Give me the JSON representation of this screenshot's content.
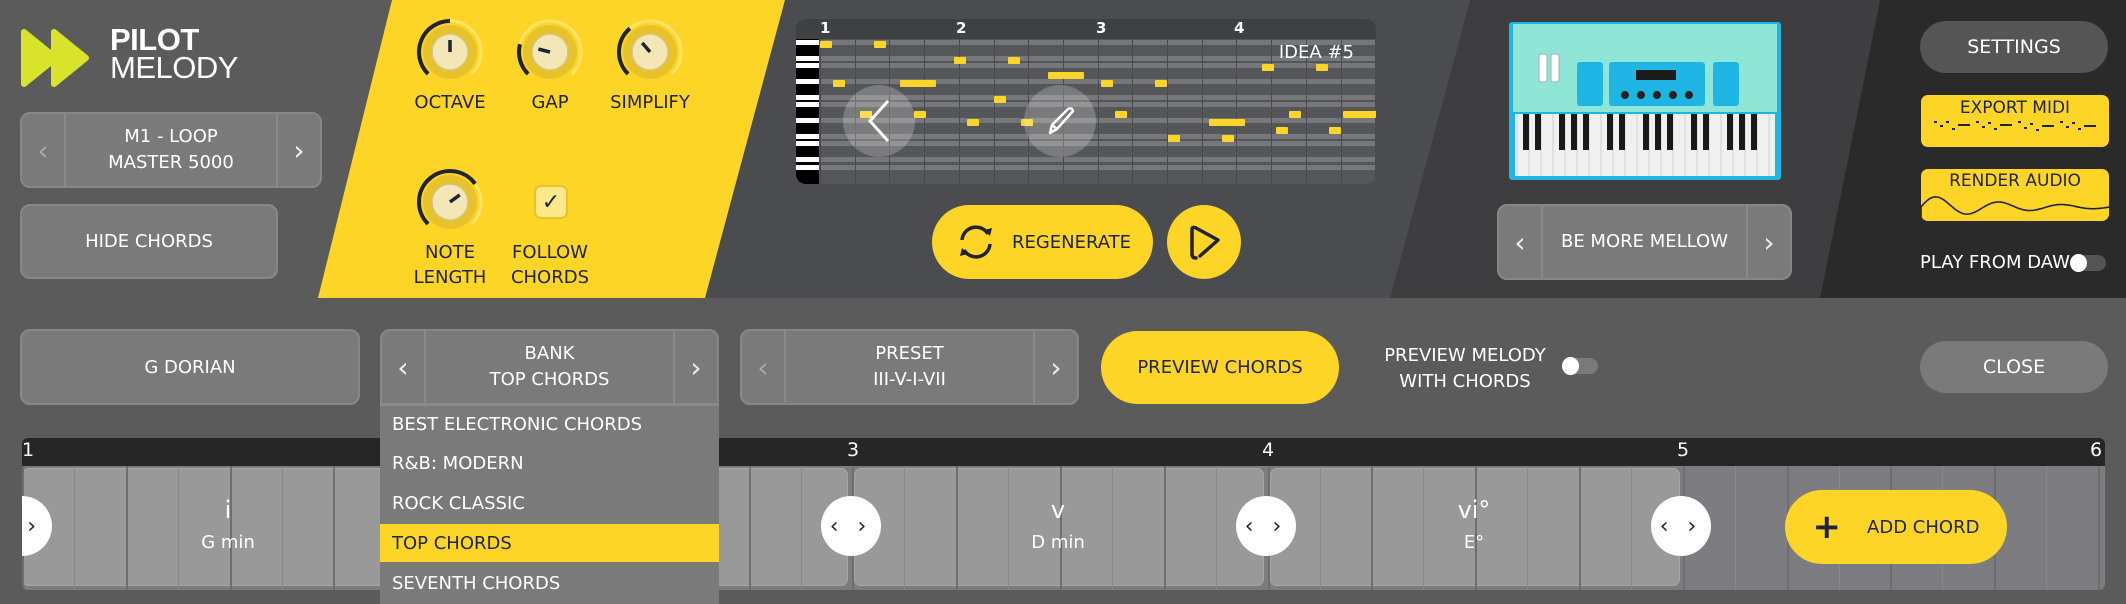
{
  "app": {
    "title_line1": "PILOT",
    "title_line2": "MELODY",
    "brand_color": "#fdd526",
    "logo_color": "#d9e32a"
  },
  "left_panel": {
    "preset_selector": {
      "line1": "M1 - LOOP",
      "line2": "MASTER 5000",
      "prev": "‹",
      "next": "›"
    },
    "hide_chords_label": "HIDE CHORDS"
  },
  "controls": {
    "knobs": [
      {
        "label": "OCTAVE",
        "value": 0.5
      },
      {
        "label": "GAP",
        "value": 0.22
      },
      {
        "label": "SIMPLIFY",
        "value": 0.35
      },
      {
        "label_line1": "NOTE",
        "label_line2": "LENGTH",
        "value": 0.7
      }
    ],
    "follow_chords": {
      "label_line1": "FOLLOW",
      "label_line2": "CHORDS",
      "checked": true
    }
  },
  "piano_roll": {
    "bar_numbers": [
      "1",
      "2",
      "3",
      "4"
    ],
    "idea_label": "IDEA #5",
    "prev_icon": "chevron-left",
    "edit_icon": "pencil"
  },
  "transport": {
    "regenerate_label": "REGENERATE",
    "play_icon": "play"
  },
  "instrument": {
    "style_selector": {
      "value": "BE MORE MELLOW",
      "prev": "‹",
      "next": "›"
    }
  },
  "right_panel": {
    "settings_label": "SETTINGS",
    "export_midi_label": "EXPORT MIDI",
    "render_audio_label": "RENDER AUDIO",
    "play_from_daw_label": "PLAY FROM DAW",
    "play_from_daw_on": false
  },
  "chord_toolbar": {
    "scale_label": "G DORIAN",
    "bank": {
      "title": "BANK",
      "value": "TOP CHORDS",
      "prev": "‹",
      "next": "›"
    },
    "preset": {
      "title": "PRESET",
      "value": "III-V-I-VII",
      "prev": "‹",
      "next": "›"
    },
    "preview_chords_label": "PREVIEW CHORDS",
    "preview_melody_line1": "PREVIEW MELODY",
    "preview_melody_line2": "WITH CHORDS",
    "preview_melody_on": false,
    "close_label": "CLOSE"
  },
  "bank_dropdown": {
    "items": [
      {
        "label": "BEST ELECTRONIC CHORDS",
        "selected": false
      },
      {
        "label": "R&B: MODERN",
        "selected": false
      },
      {
        "label": "ROCK CLASSIC",
        "selected": false
      },
      {
        "label": "TOP CHORDS",
        "selected": true
      },
      {
        "label": "SEVENTH CHORDS",
        "selected": false
      }
    ]
  },
  "chord_track": {
    "bar_numbers": [
      "1",
      "3",
      "4",
      "5",
      "6"
    ],
    "chords": [
      {
        "numeral": "i",
        "name": "G min"
      },
      {
        "numeral": "v",
        "name": "D min"
      },
      {
        "numeral": "vi°",
        "name": "E°"
      }
    ],
    "add_chord_label": "ADD CHORD",
    "handle_icon": "‹ ›"
  }
}
